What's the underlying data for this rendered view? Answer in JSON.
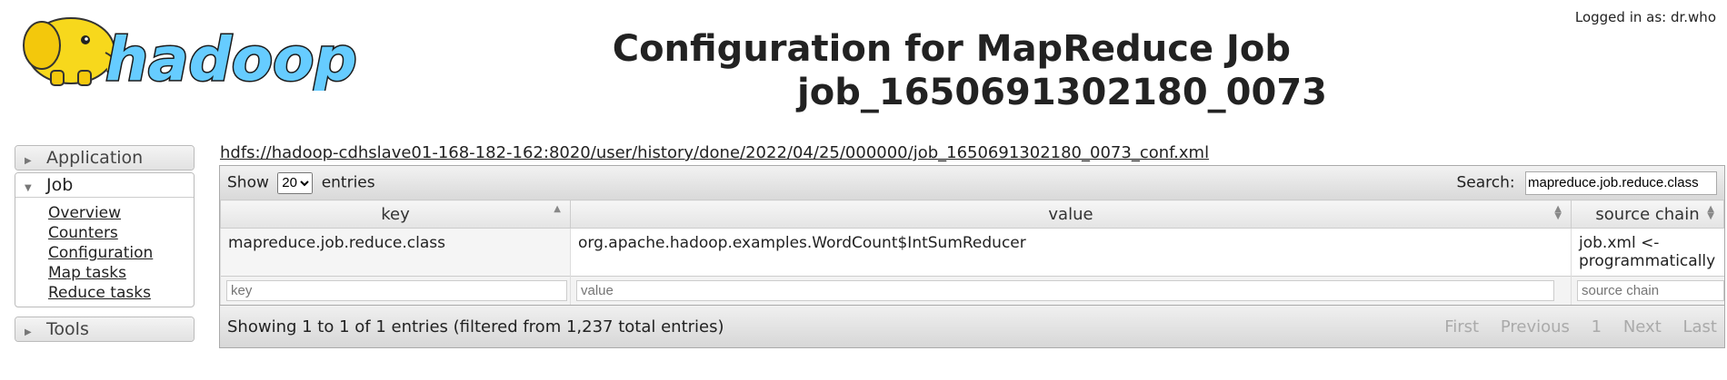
{
  "header": {
    "login_text": "Logged in as: dr.who",
    "title_line1": "Configuration for MapReduce Job",
    "title_line2": "job_1650691302180_0073",
    "logo_text": "hadoop"
  },
  "sidebar": {
    "application_label": "Application",
    "job_label": "Job",
    "job_items": [
      "Overview",
      "Counters",
      "Configuration",
      "Map tasks",
      "Reduce tasks"
    ],
    "tools_label": "Tools"
  },
  "main": {
    "conf_path": "hdfs://hadoop-cdhslave01-168-182-162:8020/user/history/done/2022/04/25/000000/job_1650691302180_0073_conf.xml",
    "show_label": "Show",
    "entries_label": "entries",
    "page_size": "20",
    "search_label": "Search:",
    "search_value": "mapreduce.job.reduce.class",
    "columns": [
      "key",
      "value",
      "source chain"
    ],
    "rows": [
      {
        "key": "mapreduce.job.reduce.class",
        "value": "org.apache.hadoop.examples.WordCount$IntSumReducer",
        "source": "job.xml <- programmatically"
      }
    ],
    "filter_placeholders": {
      "key": "key",
      "value": "value",
      "source": "source chain"
    },
    "info_text": "Showing 1 to 1 of 1 entries (filtered from 1,237 total entries)",
    "pager": {
      "first": "First",
      "previous": "Previous",
      "page": "1",
      "next": "Next",
      "last": "Last"
    }
  },
  "colors": {
    "logo_yellow": "#f7d81c",
    "logo_blue": "#66ccff"
  }
}
